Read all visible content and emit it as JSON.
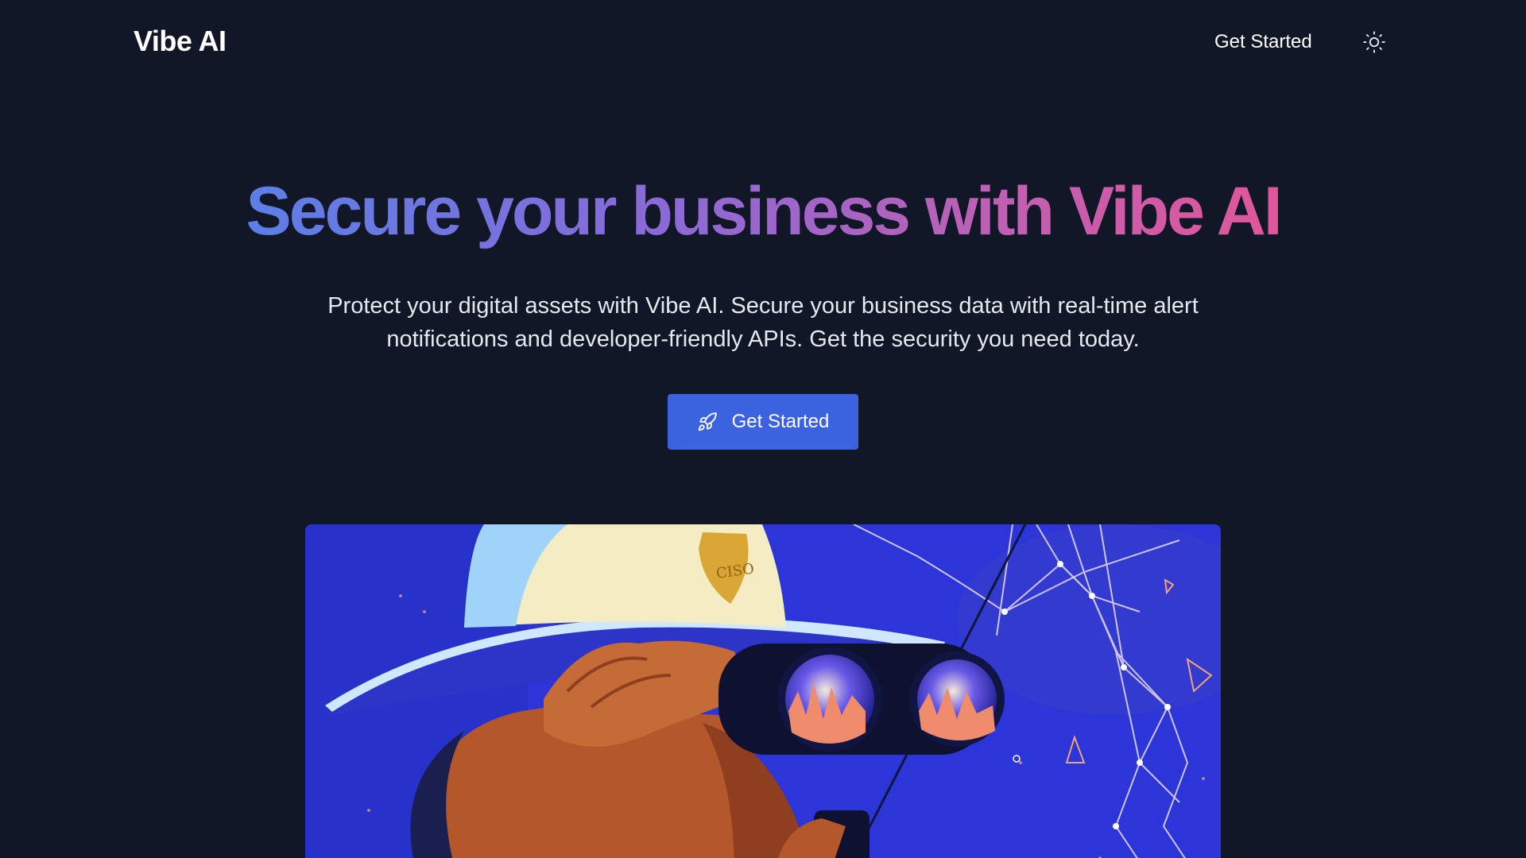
{
  "header": {
    "logo": "Vibe AI",
    "nav_get_started": "Get Started",
    "theme_icon": "sun-icon"
  },
  "hero": {
    "title": "Secure your business with Vibe AI",
    "subtitle": "Protect your digital assets with Vibe AI. Secure your business data with real-time alert notifications and developer-friendly APIs. Get the security you need today.",
    "cta_label": "Get Started",
    "cta_icon": "rocket-icon"
  },
  "illustration": {
    "badge_text": "CISO"
  },
  "colors": {
    "background": "#111726",
    "cta": "#3b63e0",
    "gradient_start": "#5b7fe6",
    "gradient_end": "#e0569a",
    "illustration_bg": "#2a36d6"
  }
}
